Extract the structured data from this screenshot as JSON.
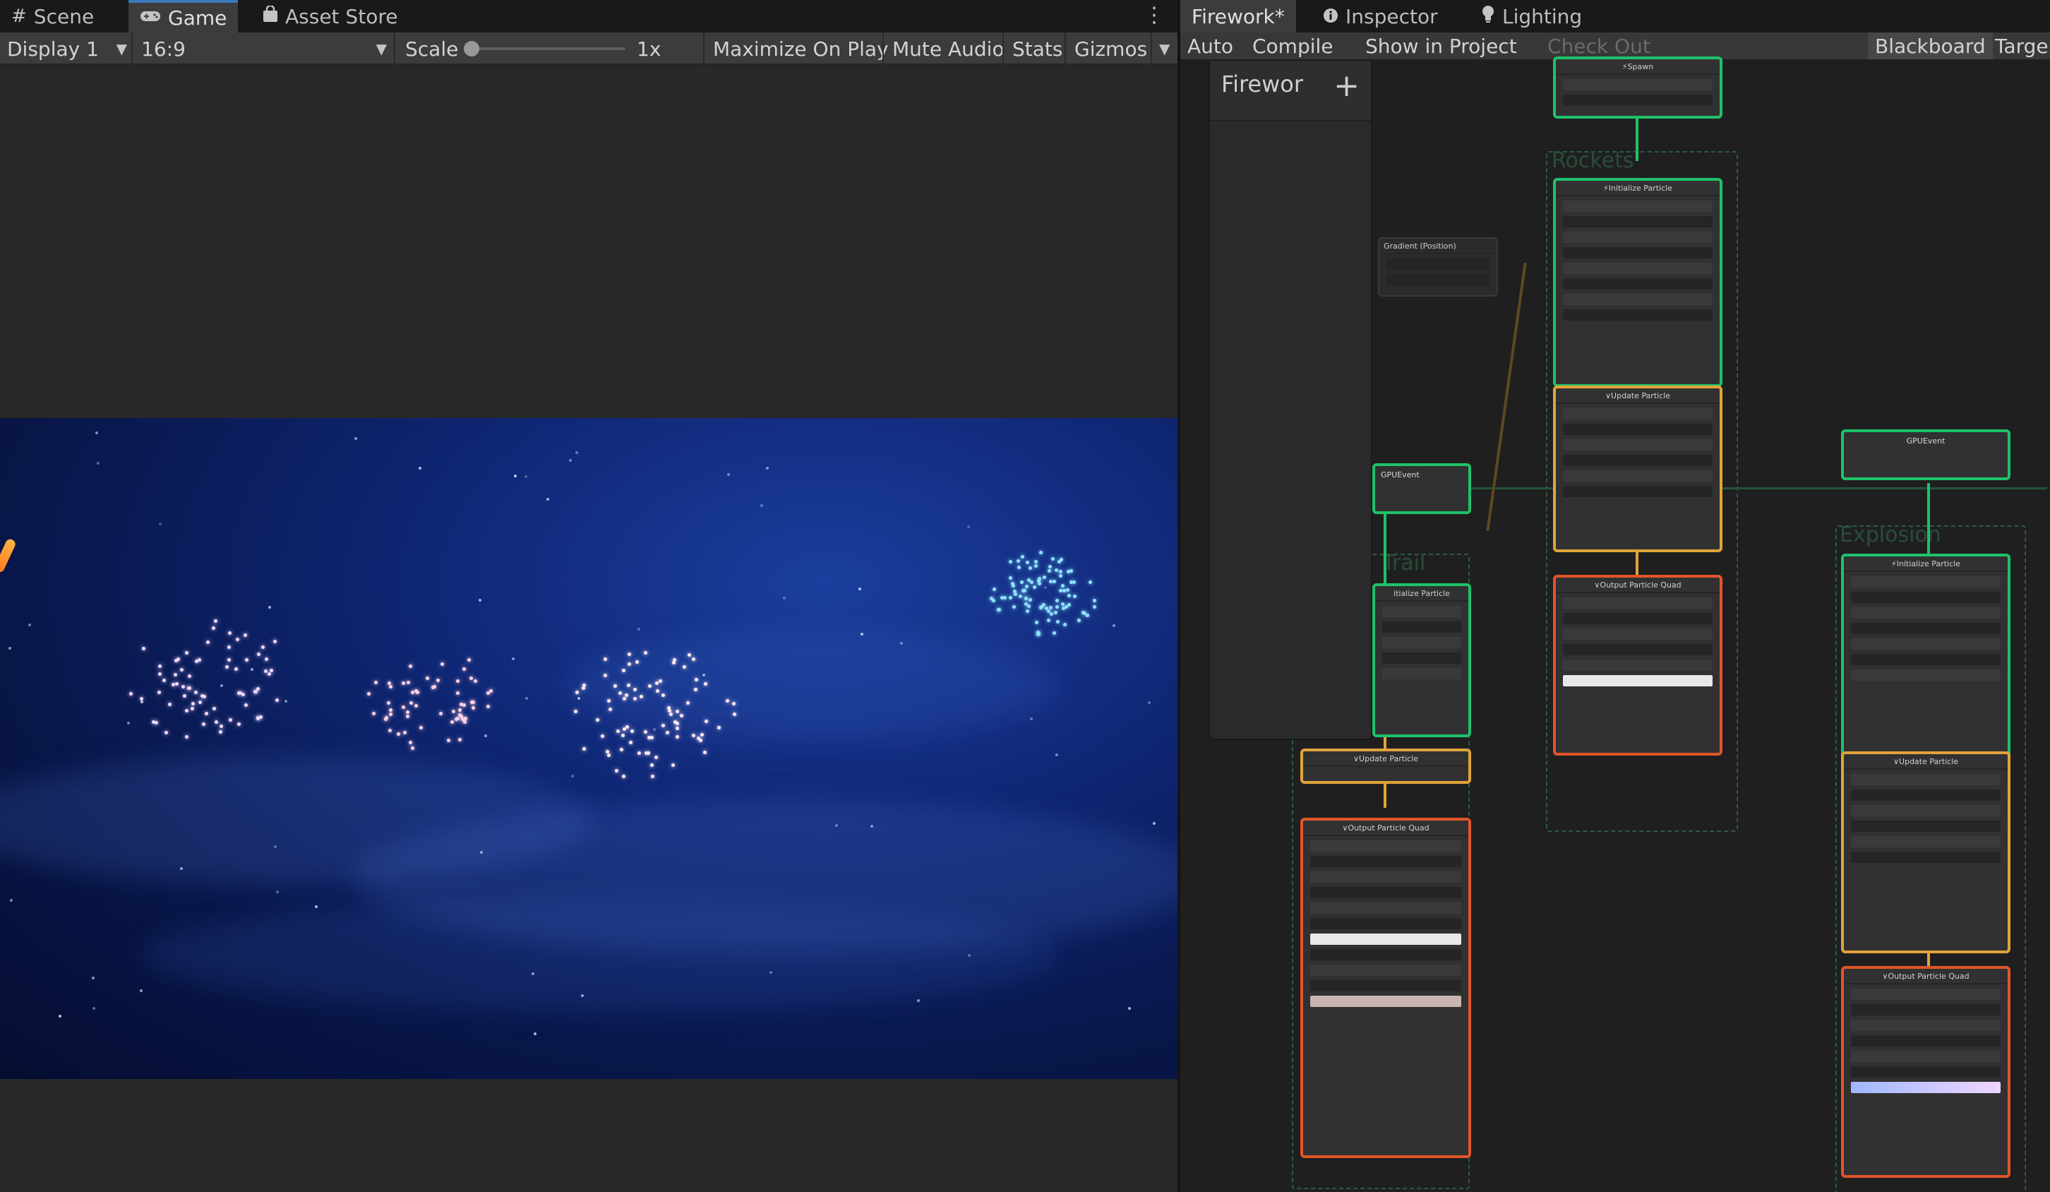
{
  "left_tabs": {
    "scene": "Scene",
    "game": "Game",
    "asset_store": "Asset Store"
  },
  "game_toolbar": {
    "display": "Display 1",
    "aspect": "16:9",
    "scale_label": "Scale",
    "scale_value": "1x",
    "maximize_on_play": "Maximize On Play",
    "mute_audio": "Mute Audio",
    "stats": "Stats",
    "gizmos": "Gizmos"
  },
  "right_tabs": {
    "firework": "Firework*",
    "inspector": "Inspector",
    "lighting": "Lighting"
  },
  "vfx_toolbar": {
    "auto": "Auto",
    "compile": "Compile",
    "show_in_project": "Show in Project",
    "check_out": "Check Out",
    "blackboard": "Blackboard",
    "target": "Targe"
  },
  "blackboard": {
    "title": "Firewor",
    "add": "+"
  },
  "graph": {
    "system_labels": [
      "Rockets",
      "Explosion",
      "Trail"
    ],
    "nodes": {
      "spawn": "Spawn",
      "init_top": "Initialize Particle",
      "update_top": "Update Particle",
      "output_top": "Output Particle Quad",
      "gpu_event_left": "GPUEvent",
      "init_left": "itialize Particle",
      "update_left": "Update Particle",
      "output_left": "Output Particle Quad",
      "gpu_event_right": "GPUEvent",
      "init_right": "Initialize Particle",
      "update_right": "Update Particle",
      "output_right": "Output Particle Quad",
      "gradient": "Gradient (Position)"
    }
  },
  "colors": {
    "context_green": "#1ec26a",
    "context_orange": "#e1a33a",
    "context_red": "#e1552a",
    "active_tab_accent": "#3a79bb"
  }
}
